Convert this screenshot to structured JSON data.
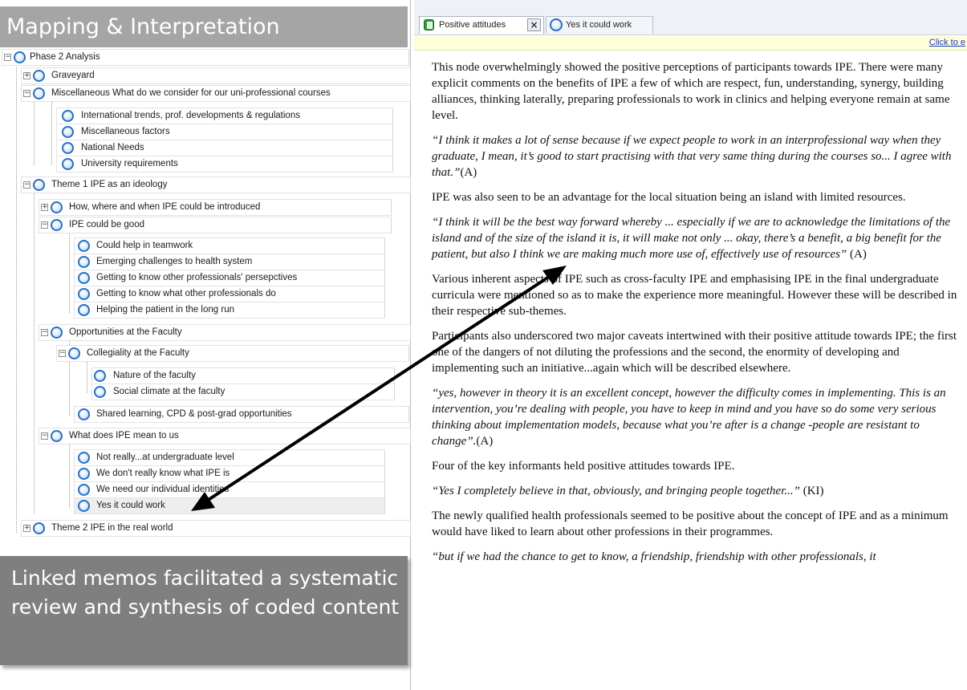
{
  "overlays": {
    "title": "Mapping & Interpretation",
    "memo_caption": "Linked memos facilitated a systematic review and synthesis of coded content"
  },
  "tree": {
    "root": "Phase 2 Analysis",
    "graveyard": "Graveyard",
    "misc": "Miscellaneous  What do we consider for our uni-professional courses",
    "misc_items": [
      "International trends, prof. developments & regulations",
      "Miscellaneous factors",
      "National Needs",
      "University requirements"
    ],
    "theme1": "Theme 1 IPE as an ideology",
    "how_where": "How, where and when IPE could be introduced",
    "could_be_good": "IPE could be good",
    "good_items": [
      "Could help in teamwork",
      "Emerging challenges to health system",
      "Getting to know other professionals' persepctives",
      "Getting to know what other professionals do",
      "Helping the patient in the long run"
    ],
    "opportunities": "Opportunities at the Faculty",
    "collegiality": "Collegiality at the Faculty",
    "collegiality_items": [
      "Nature of the faculty",
      "Social climate at the faculty"
    ],
    "shared_learning": "Shared learning, CPD &  post-grad  opportunities",
    "what_does": "What does IPE mean to us",
    "what_items": [
      "Not really...at undergraduate level",
      "We don't really know what IPE is",
      "We need our individual identities",
      "Yes it could work"
    ],
    "theme2": "Theme 2 IPE in the real world"
  },
  "tabs": {
    "positive": "Positive attitudes",
    "close": "×",
    "yes": "Yes it could work"
  },
  "info_link": "Click to e",
  "memo": {
    "p1": "This node overwhelmingly showed the positive perceptions of participants towards IPE. There were many explicit comments on the benefits of IPE a few of which are respect, fun, understanding, synergy, building alliances, thinking laterally, preparing professionals to work in clinics and helping everyone remain at same level.",
    "q1": "“I think it makes a lot of sense because if we expect people to work in an interprofessional way when they graduate, I mean, it’s good to start practising with that very same thing during the courses so... I agree with that.”",
    "q1_attr": "(A)",
    "p2": "IPE was also seen to be an advantage for the local situation being an island with limited resources.",
    "q2": "“I think it will be the best way forward whereby ... especially if we are to acknowledge the limitations of the island and of the size of the island it is, it will make not only ... okay, there’s a benefit, a big benefit for the patient, but also I think we are making much more use of, effectively use of resources”",
    "q2_attr": " (A)",
    "p3": "Various inherent aspects of IPE such as cross-faculty IPE and emphasising IPE in the final undergraduate curricula were mentioned so as to make the experience more meaningful. However these will be described in their respective sub-themes.",
    "p4": "Participants also underscored two major caveats intertwined with their positive attitude towards IPE; the first one of the dangers of not diluting the professions and the second, the enormity of developing and implementing such an initiative...again which will be described elsewhere.",
    "q3": "“yes, however in theory it is an excellent concept, however the difficulty comes in implementing. This is an intervention, you’re dealing with people, you have to keep in mind and you have so do some very serious thinking about implementation models, because what you’re after is a change -people are resistant to change”.",
    "q3_attr": "(A)",
    "p5": "Four of the key informants held positive attitudes towards IPE.",
    "q4": "“Yes I completely believe in that, obviously, and bringing people together...”",
    "q4_attr": " (KI)",
    "p6": "The newly qualified health professionals seemed to be positive about the concept of IPE and as a minimum would have liked to learn about other professions in their programmes.",
    "q5": "“but if we had the chance to get to know, a friendship, friendship with other professionals, it"
  }
}
